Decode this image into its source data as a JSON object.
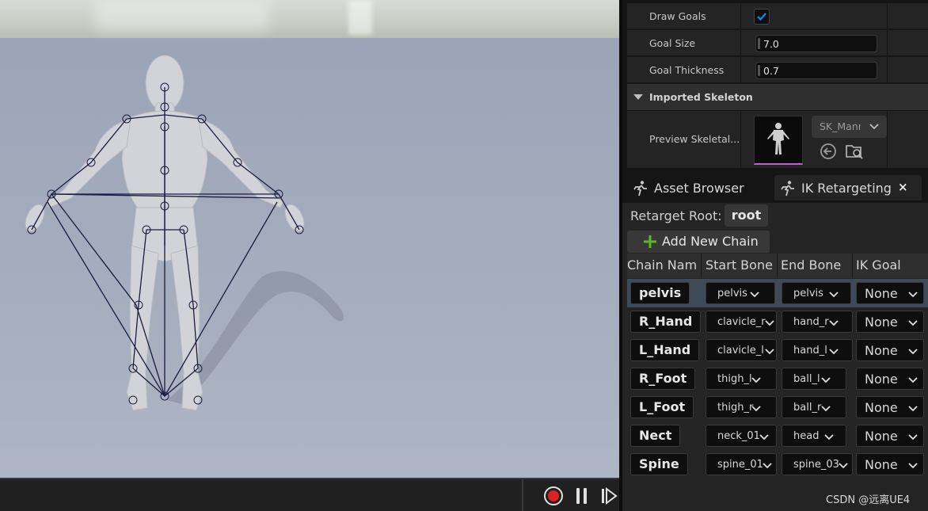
{
  "details": {
    "draw_goals": {
      "label": "Draw Goals",
      "checked": true
    },
    "goal_size": {
      "label": "Goal Size",
      "value": "7.0"
    },
    "goal_thickness": {
      "label": "Goal Thickness",
      "value": "0.7"
    },
    "category": "Imported Skeleton",
    "preview_skeletal": {
      "label": "Preview Skeletal...",
      "asset": "SK_Mann"
    }
  },
  "tabs": [
    {
      "label": "Asset Browser",
      "icon": "running-figure-icon"
    },
    {
      "label": "IK Retargeting",
      "icon": "running-figure-icon",
      "closable": true,
      "close_glyph": "×"
    }
  ],
  "retarget": {
    "root_label": "Retarget Root:",
    "root_value": "root",
    "add_chain_label": "Add New Chain"
  },
  "table": {
    "headers": [
      "Chain Nam",
      "Start Bone",
      "End Bone",
      "IK Goal"
    ],
    "rows": [
      {
        "chain": "pelvis",
        "start": "pelvis",
        "end": "pelvis",
        "goal": "None",
        "selected": true
      },
      {
        "chain": "R_Hand",
        "start": "clavicle_r",
        "end": "hand_r",
        "goal": "None"
      },
      {
        "chain": "L_Hand",
        "start": "clavicle_l",
        "end": "hand_l",
        "goal": "None"
      },
      {
        "chain": "R_Foot",
        "start": "thigh_l",
        "end": "ball_l",
        "goal": "None"
      },
      {
        "chain": "L_Foot",
        "start": "thigh_r",
        "end": "ball_r",
        "goal": "None"
      },
      {
        "chain": "Nect",
        "start": "neck_01",
        "end": "head",
        "goal": "None"
      },
      {
        "chain": "Spine",
        "start": "spine_01",
        "end": "spine_03",
        "goal": "None"
      }
    ]
  },
  "toolbar": {
    "record_icon": "record-icon",
    "pause_icon": "pause-icon",
    "step_icon": "step-forward-icon"
  },
  "watermark": "CSDN @远离UE4",
  "colors": {
    "accent_blue": "#1e7fe0",
    "record_red": "#e02020",
    "add_green": "#5cb82a",
    "asset_pink": "#c45bd1"
  }
}
